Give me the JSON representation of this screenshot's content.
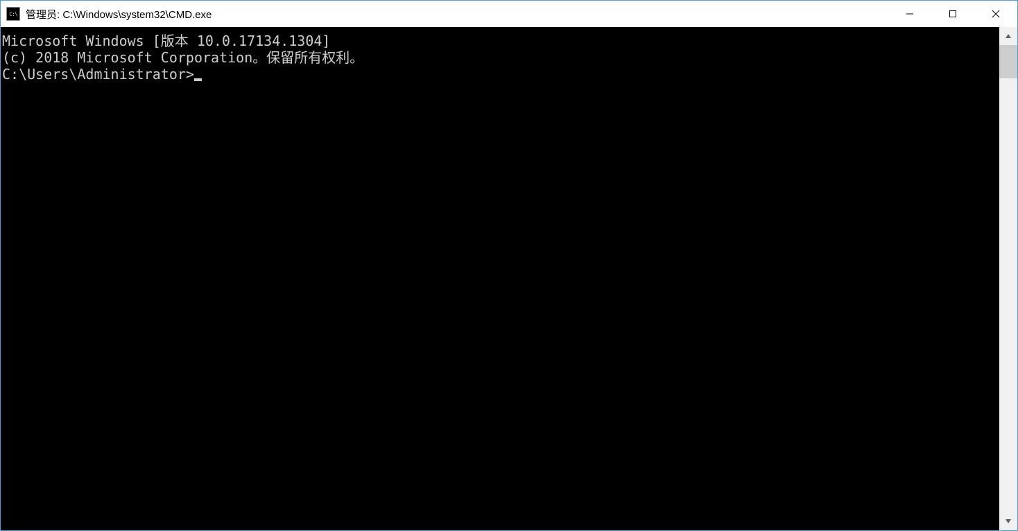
{
  "window": {
    "title": "管理员: C:\\Windows\\system32\\CMD.exe",
    "icon_label": "C:\\"
  },
  "terminal": {
    "lines": [
      "Microsoft Windows [版本 10.0.17134.1304]",
      "(c) 2018 Microsoft Corporation。保留所有权利。",
      ""
    ],
    "prompt": "C:\\Users\\Administrator>"
  }
}
